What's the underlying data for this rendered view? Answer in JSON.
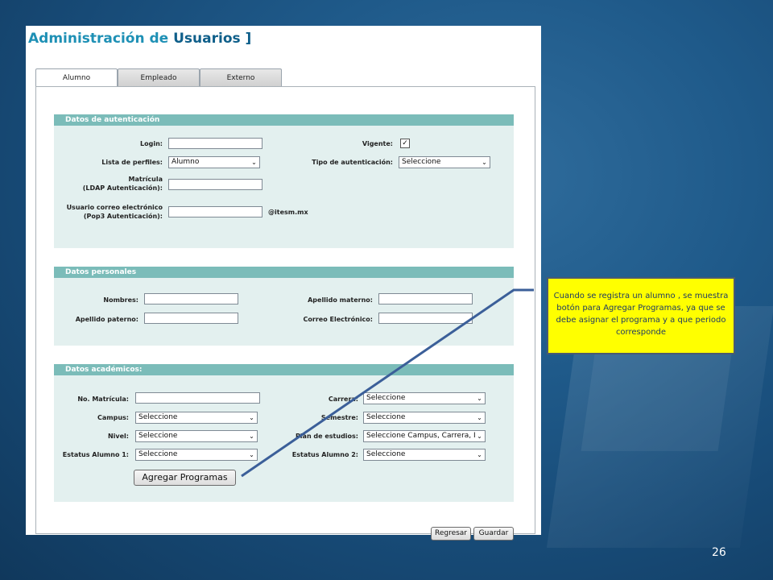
{
  "title": {
    "part1": "Administración de",
    "part2": "Usuarios ]"
  },
  "tabs": [
    {
      "label": "Alumno",
      "active": true
    },
    {
      "label": "Empleado",
      "active": false
    },
    {
      "label": "Externo",
      "active": false
    }
  ],
  "auth": {
    "header": "Datos de autenticación",
    "login_label": "Login:",
    "login_value": "",
    "vigente_label": "Vigente:",
    "vigente_checked": true,
    "perfiles_label": "Lista de perfiles:",
    "perfiles_value": "Alumno",
    "tipo_auth_label": "Tipo de autenticación:",
    "tipo_auth_value": "Seleccione",
    "matricula_label_1": "Matrícula",
    "matricula_label_2": "(LDAP Autenticación):",
    "matricula_value": "",
    "correo_label_1": "Usuario correo electrónico",
    "correo_label_2": "(Pop3 Autenticación):",
    "correo_value": "",
    "correo_suffix": "@itesm.mx"
  },
  "personal": {
    "header": "Datos personales",
    "nombres_label": "Nombres:",
    "nombres_value": "",
    "apellido_materno_label": "Apellido materno:",
    "apellido_materno_value": "",
    "apellido_paterno_label": "Apellido paterno:",
    "apellido_paterno_value": "",
    "correo_label": "Correo Electrónico:",
    "correo_value": ""
  },
  "academic": {
    "header": "Datos académicos:",
    "no_matricula_label": "No. Matrícula:",
    "no_matricula_value": "",
    "carrera_label": "Carrera:",
    "carrera_value": "Seleccione",
    "campus_label": "Campus:",
    "campus_value": "Seleccione",
    "semestre_label": "Semestre:",
    "semestre_value": "Seleccione",
    "nivel_label": "Nivel:",
    "nivel_value": "Seleccione",
    "plan_label": "Plan de estudios:",
    "plan_value": "Seleccione Campus, Carrera, I",
    "estatus1_label": "Estatus Alumno 1:",
    "estatus1_value": "Seleccione",
    "estatus2_label": "Estatus Alumno 2:",
    "estatus2_value": "Seleccione",
    "agregar_button": "Agregar Programas"
  },
  "footer": {
    "regresar_button": "Regresar",
    "guardar_button": "Guardar"
  },
  "callout": {
    "text": "Cuando se registra un alumno , se muestra botón para Agregar Programas, ya que se debe asignar el programa y a que periodo corresponde"
  },
  "slide_number": "26",
  "colors": {
    "section_header": "#7bbcb9",
    "section_bg": "#e3f0ef",
    "title": "#1e90b5",
    "callout_bg": "#ffff00",
    "arrow_line": "#3b5f99"
  },
  "icons": {
    "select_arrow": "chevron-down-icon",
    "checkbox": "check-icon"
  }
}
